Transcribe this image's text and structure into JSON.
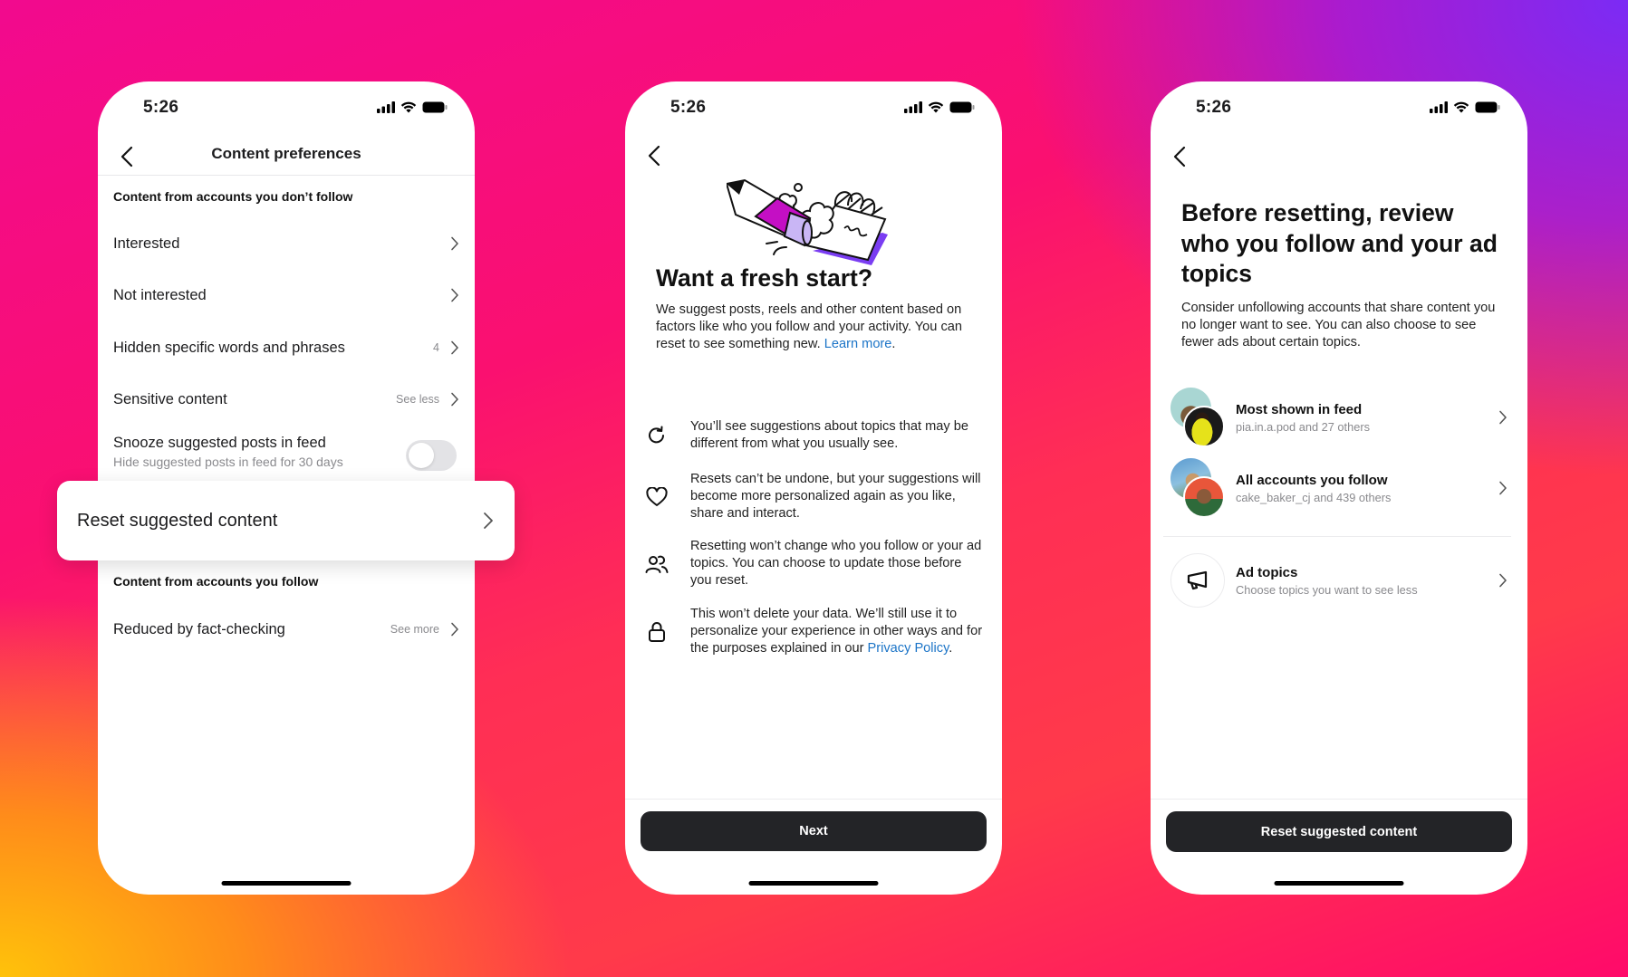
{
  "background": {
    "gradient_colors": [
      "#f20a8e",
      "#7b2bf5",
      "#ffc20a",
      "#ff3a4a",
      "#ff0a6a"
    ]
  },
  "status_bar": {
    "time": "5:26",
    "icons": [
      "signal-icon",
      "wifi-icon",
      "battery-icon"
    ]
  },
  "screen1": {
    "title": "Content preferences",
    "section1_header": "Content from accounts you don’t follow",
    "items": [
      {
        "label": "Interested",
        "meta": ""
      },
      {
        "label": "Not interested",
        "meta": ""
      },
      {
        "label": "Hidden specific words and phrases",
        "meta": "4"
      },
      {
        "label": "Sensitive content",
        "meta": "See less"
      }
    ],
    "snooze": {
      "title": "Snooze suggested posts in feed",
      "subtitle": "Hide suggested posts in feed for 30 days",
      "enabled": false
    },
    "reset_card": {
      "label": "Reset suggested content"
    },
    "section2_header": "Content from accounts you follow",
    "items2": [
      {
        "label": "Reduced by fact-checking",
        "meta": "See more"
      }
    ]
  },
  "screen2": {
    "headline": "Want a fresh start?",
    "body": "We suggest posts, reels and other content based on factors like who you follow and your activity. You can reset to see something new.",
    "learn_more": "Learn more",
    "info": [
      {
        "icon": "refresh-icon",
        "text": "You’ll see suggestions about topics that may be different from what you usually see."
      },
      {
        "icon": "heart-icon",
        "text": "Resets can’t be undone, but your suggestions will become more personalized again as you like, share and interact."
      },
      {
        "icon": "people-icon",
        "text": "Resetting won’t change who you follow or your ad topics. You can choose to update those before you reset."
      },
      {
        "icon": "lock-icon",
        "text": "This won’t delete your data. We’ll still use it to personalize your experience in other ways and for the purposes explained in our",
        "link": "Privacy Policy",
        "suffix": "."
      }
    ],
    "button": "Next",
    "link_color": "#1b74c7"
  },
  "screen3": {
    "headline": "Before resetting, review who you follow and your ad topics",
    "body": "Consider unfollowing accounts that share content you no longer want to see. You can also choose to see fewer ads about certain topics.",
    "rows": [
      {
        "title": "Most shown in feed",
        "subtitle": "pia.in.a.pod and 27 others"
      },
      {
        "title": "All accounts you follow",
        "subtitle": "cake_baker_cj and 439 others"
      },
      {
        "title": "Ad topics",
        "subtitle": "Choose topics you want to see less"
      }
    ],
    "button": "Reset suggested content"
  }
}
